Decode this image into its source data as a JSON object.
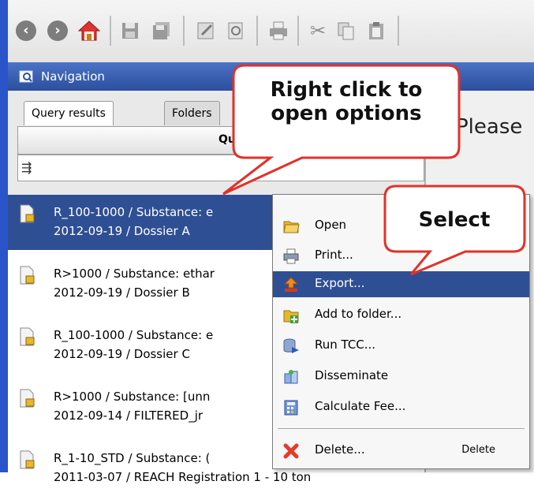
{
  "toolbar": {
    "buttons": [
      "back-icon",
      "forward-icon",
      "home-icon",
      "save-icon",
      "save-all-icon",
      "edit-icon",
      "preview-icon",
      "print-icon",
      "cut-icon",
      "copy-icon",
      "paste-icon"
    ]
  },
  "navigation": {
    "title": "Navigation"
  },
  "tabs": [
    "Query results",
    "Folders"
  ],
  "column_header": "Query",
  "right_pane_text": "Please",
  "results": [
    {
      "line1": "R_100-1000 / Substance: e",
      "line2": "2012-09-19 / Dossier A",
      "selected": true
    },
    {
      "line1": "R>1000 / Substance: ethar",
      "line2": "2012-09-19 / Dossier B",
      "selected": false
    },
    {
      "line1": "R_100-1000 / Substance: e",
      "line2": "2012-09-19 / Dossier C",
      "selected": false
    },
    {
      "line1": "R>1000 / Substance: [unn",
      "line2": "2012-09-14 / FILTERED_jr",
      "selected": false
    },
    {
      "line1": "R_1-10_STD / Substance: (",
      "line2": "2011-03-07 / REACH Registration 1 - 10 ton",
      "selected": false
    }
  ],
  "context_menu": {
    "items": [
      {
        "label": "Open",
        "icon": "folder-icon"
      },
      {
        "label": "Print...",
        "icon": "print-icon"
      },
      {
        "label": "Export...",
        "icon": "export-icon",
        "highlighted": true
      },
      {
        "label": "Add to folder...",
        "icon": "add-folder-icon"
      },
      {
        "label": "Run TCC...",
        "icon": "database-icon"
      },
      {
        "label": "Disseminate",
        "icon": "disseminate-icon"
      },
      {
        "label": "Calculate Fee...",
        "icon": "calculator-icon"
      },
      {
        "label": "Delete...",
        "icon": "delete-icon",
        "accelerator": "Delete"
      }
    ]
  },
  "callouts": {
    "right_click": "Right click to open options",
    "select": "Select"
  },
  "colors": {
    "selection": "#2f4f94",
    "nav_header": "#3a62b6",
    "callout_border": "#e0322a"
  }
}
